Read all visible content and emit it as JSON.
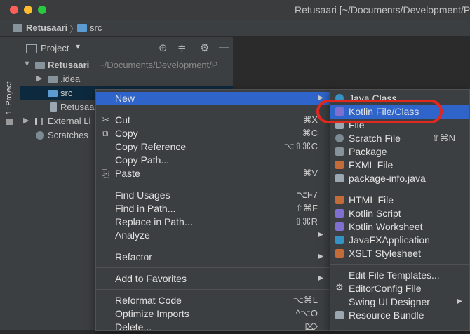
{
  "window": {
    "title": "Retusaari [~/Documents/Development/P"
  },
  "breadcrumb": {
    "project": "Retusaari",
    "folder": "src"
  },
  "side_strip": {
    "tab_label": "1: Project"
  },
  "panel": {
    "title": "Project"
  },
  "tree": {
    "root": {
      "name": "Retusaari",
      "path": "~/Documents/Development/P"
    },
    "idea": ".idea",
    "src": "src",
    "file": "Retusaa",
    "external": "External Li",
    "scratches": "Scratches"
  },
  "context_menu": {
    "new": "New",
    "cut": {
      "label": "Cut",
      "shortcut": "⌘X"
    },
    "copy": {
      "label": "Copy",
      "shortcut": "⌘C"
    },
    "copy_reference": {
      "label": "Copy Reference",
      "shortcut": "⌥⇧⌘C"
    },
    "copy_path": {
      "label": "Copy Path..."
    },
    "paste": {
      "label": "Paste",
      "shortcut": "⌘V"
    },
    "find_usages": {
      "label": "Find Usages",
      "shortcut": "⌥F7"
    },
    "find_in_path": {
      "label": "Find in Path...",
      "shortcut": "⇧⌘F"
    },
    "replace_in_path": {
      "label": "Replace in Path...",
      "shortcut": "⇧⌘R"
    },
    "analyze": {
      "label": "Analyze"
    },
    "refactor": {
      "label": "Refactor"
    },
    "add_to_favorites": {
      "label": "Add to Favorites"
    },
    "reformat_code": {
      "label": "Reformat Code",
      "shortcut": "⌥⌘L"
    },
    "optimize_imports": {
      "label": "Optimize Imports",
      "shortcut": "^⌥O"
    },
    "delete": {
      "label": "Delete...",
      "shortcut": "⌦"
    }
  },
  "new_submenu": {
    "java_class": "Java Class",
    "kotlin_file_class": "Kotlin File/Class",
    "file": "File",
    "scratch_file": {
      "label": "Scratch File",
      "shortcut": "⇧⌘N"
    },
    "package": "Package",
    "fxml_file": "FXML File",
    "package_info": "package-info.java",
    "html_file": "HTML File",
    "kotlin_script": "Kotlin Script",
    "kotlin_worksheet": "Kotlin Worksheet",
    "javafx_application": "JavaFXApplication",
    "xslt_stylesheet": "XSLT Stylesheet",
    "edit_file_templates": "Edit File Templates...",
    "editorconfig_file": "EditorConfig File",
    "swing_ui_designer": "Swing UI Designer",
    "resource_bundle": "Resource Bundle"
  },
  "colors": {
    "highlight": "#2f65ca",
    "annotation_ring": "#e1281e",
    "background": "#2b2b2b",
    "panel": "#3c3f41"
  }
}
